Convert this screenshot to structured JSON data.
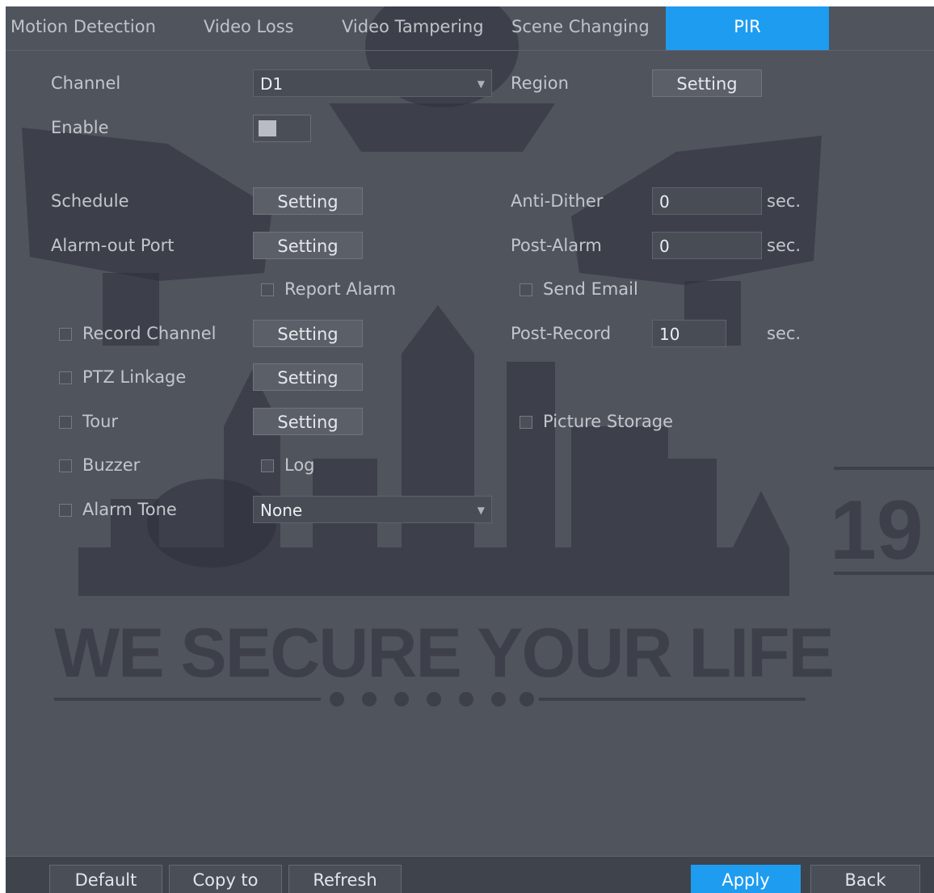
{
  "tabs": [
    {
      "label": "Motion Detection"
    },
    {
      "label": "Video Loss"
    },
    {
      "label": "Video Tampering"
    },
    {
      "label": "Scene Changing"
    },
    {
      "label": "PIR",
      "active": true
    }
  ],
  "form": {
    "channel_label": "Channel",
    "channel_value": "D1",
    "region_label": "Region",
    "region_button": "Setting",
    "enable_label": "Enable",
    "enable_on": false,
    "schedule_label": "Schedule",
    "schedule_button": "Setting",
    "anti_dither_label": "Anti-Dither",
    "anti_dither_value": "0",
    "anti_dither_unit": "sec.",
    "alarm_out_label": "Alarm-out Port",
    "alarm_out_button": "Setting",
    "post_alarm_label": "Post-Alarm",
    "post_alarm_value": "0",
    "post_alarm_unit": "sec.",
    "report_alarm_label": "Report Alarm",
    "send_email_label": "Send Email",
    "record_channel_label": "Record Channel",
    "record_channel_button": "Setting",
    "post_record_label": "Post-Record",
    "post_record_value": "10",
    "post_record_unit": "sec.",
    "ptz_label": "PTZ Linkage",
    "ptz_button": "Setting",
    "tour_label": "Tour",
    "tour_button": "Setting",
    "picture_storage_label": "Picture Storage",
    "buzzer_label": "Buzzer",
    "log_label": "Log",
    "alarm_tone_label": "Alarm Tone",
    "alarm_tone_value": "None"
  },
  "footer": {
    "default": "Default",
    "copy_to": "Copy to",
    "refresh": "Refresh",
    "apply": "Apply",
    "back": "Back"
  },
  "watermark": {
    "slogan": "WE SECURE YOUR LIFE",
    "number": "19"
  },
  "colors": {
    "accent": "#1e9cf0",
    "panel": "#50545d"
  }
}
